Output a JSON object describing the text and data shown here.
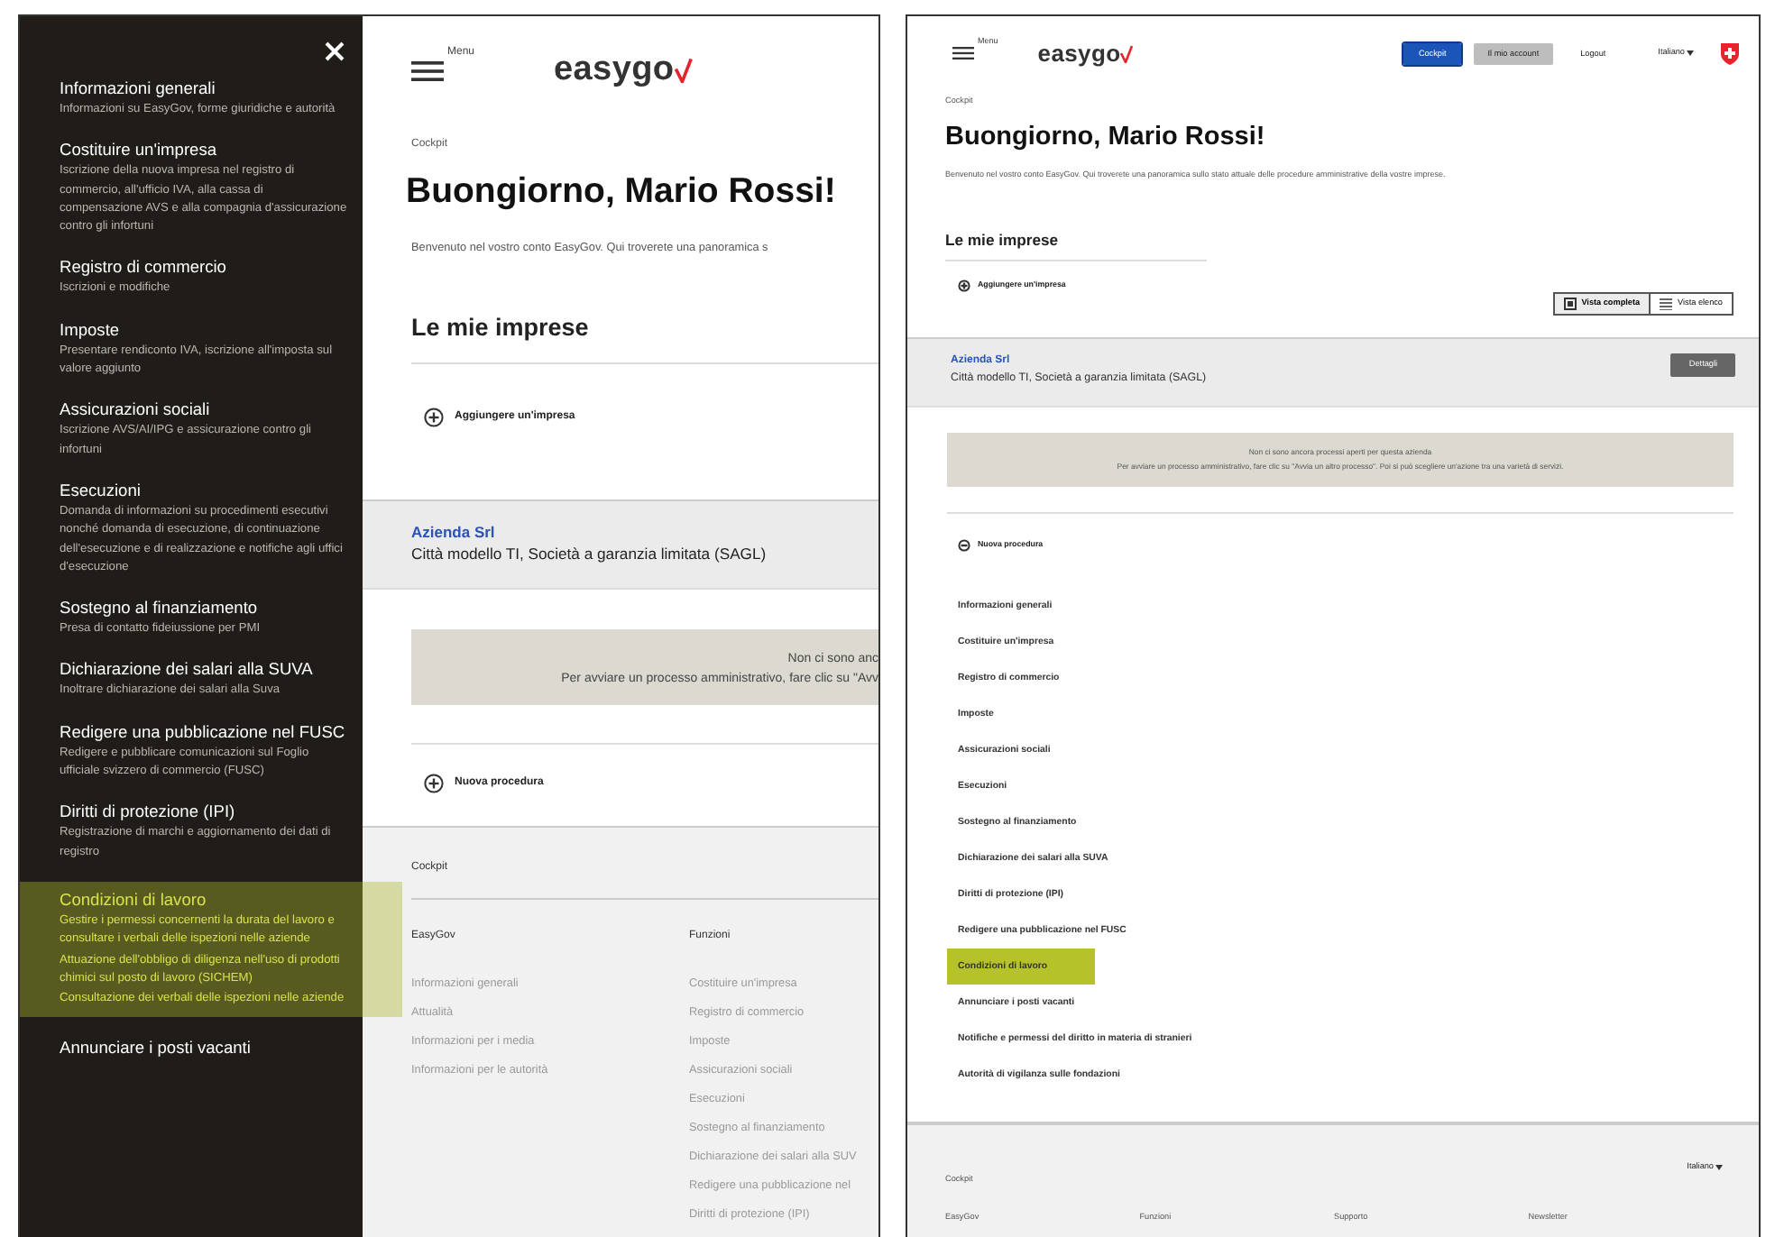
{
  "left_screen": {
    "menu": {
      "items": [
        {
          "title": "Informazioni generali",
          "description": [
            "Informazioni su EasyGov, forme giuridiche e autorità"
          ],
          "selected": false
        },
        {
          "title": "Costituire un'impresa",
          "description": [
            "Iscrizione della nuova impresa nel registro di commercio, all'ufficio IVA, alla cassa di compensazione AVS e alla compagnia d'assicurazione contro gli infortuni"
          ],
          "selected": false
        },
        {
          "title": "Registro di commercio",
          "description": [
            "Iscrizioni e modifiche"
          ],
          "selected": false
        },
        {
          "title": "Imposte",
          "description": [
            "Presentare rendiconto IVA, iscrizione all'imposta sul valore aggiunto"
          ],
          "selected": false
        },
        {
          "title": "Assicurazioni sociali",
          "description": [
            "Iscrizione AVS/AI/IPG e assicurazione contro gli infortuni"
          ],
          "selected": false
        },
        {
          "title": "Esecuzioni",
          "description": [
            "Domanda di informazioni su procedimenti esecutivi nonché domanda di esecuzione, di continuazione dell'esecuzione e di realizzazione e notifiche agli uffici d'esecuzione"
          ],
          "selected": false
        },
        {
          "title": "Sostegno al finanziamento",
          "description": [
            "Presa di contatto fideiussione per PMI"
          ],
          "selected": false
        },
        {
          "title": "Dichiarazione dei salari alla SUVA",
          "description": [
            "Inoltrare dichiarazione dei salari alla Suva"
          ],
          "selected": false
        },
        {
          "title": "Redigere una pubblicazione nel FUSC",
          "description": [
            "Redigere e pubblicare comunicazioni sul Foglio ufficiale svizzero di commercio (FUSC)"
          ],
          "selected": false
        },
        {
          "title": "Diritti di protezione (IPI)",
          "description": [
            "Registrazione di marchi e aggiornamento dei dati di registro"
          ],
          "selected": false
        },
        {
          "title": "Condizioni di lavoro",
          "description": [
            "Gestire i permessi concernenti la durata del lavoro e consultare i verbali delle ispezioni nelle aziende",
            "Attuazione dell'obbligo di diligenza nell'uso di prodotti chimici sul posto di lavoro (SICHEM)",
            "Consultazione dei verbali delle ispezioni nelle aziende"
          ],
          "selected": true
        },
        {
          "title": "Annunciare i posti vacanti",
          "selected": false
        }
      ]
    },
    "header": {
      "menu_label": "Menu",
      "logo": "easygo"
    },
    "breadcrumb": "Cockpit",
    "greeting": "Buongiorno, Mario Rossi!",
    "welcome": "Benvenuto nel vostro conto EasyGov. Qui troverete una panoramica s",
    "section_title": "Le mie imprese",
    "add_company": "Aggiungere un'impresa",
    "company": {
      "name": "Azienda Srl",
      "details": "Città modello TI, Società a garanzia limitata (SAGL)"
    },
    "notice": [
      "Non ci sono anc",
      "Per avviare un processo amministrativo, fare clic su \"Avv"
    ],
    "new_procedure": {
      "label": "Nuova procedura",
      "expanded": false
    },
    "footer": {
      "breadcrumb": "Cockpit",
      "columns": [
        {
          "heading": "EasyGov",
          "links": [
            "Informazioni generali",
            "Attualità",
            "Informazioni per i media",
            "Informazioni per le autorità"
          ]
        },
        {
          "heading": "Funzioni",
          "links": [
            "Costituire un'impresa",
            "Registro di commercio",
            "Imposte",
            "Assicurazioni sociali",
            "Esecuzioni",
            "Sostegno al finanziamento",
            "Dichiarazione dei salari alla SUV",
            "Redigere una pubblicazione nel",
            "Diritti di protezione (IPI)"
          ]
        }
      ]
    }
  },
  "right_screen": {
    "header": {
      "menu_label": "Menu",
      "logo": "easygo",
      "nav": [
        {
          "label": "Cockpit",
          "kind": "primary",
          "selected": true
        },
        {
          "label": "Il mio account",
          "kind": "secondary",
          "selected": false
        },
        {
          "label": "Logout",
          "kind": "link",
          "selected": false
        }
      ],
      "language": "Italiano"
    },
    "breadcrumb": "Cockpit",
    "greeting": "Buongiorno, Mario Rossi!",
    "welcome": "Benvenuto nel vostro conto EasyGov. Qui troverete una panoramica sullo stato attuale delle procedure amministrative della vostre imprese.",
    "section_title": "Le mie imprese",
    "add_company": "Aggiungere un'impresa",
    "views": [
      {
        "label": "Vista completa",
        "selected": true
      },
      {
        "label": "Vista elenco",
        "selected": false
      }
    ],
    "company": {
      "name": "Azienda Srl",
      "details": "Città modello TI, Società a garanzia limitata (SAGL)",
      "details_button": "Dettagli"
    },
    "notice": [
      "Non ci sono ancora processi aperti per questa azienda",
      "Per avviare un processo amministrativo, fare clic su \"Avvia un altro processo\". Poi si può scegliere un'azione tra una varietà di servizi."
    ],
    "new_procedure": {
      "label": "Nuova procedura",
      "expanded": true
    },
    "procedures": [
      {
        "label": "Informazioni generali",
        "selected": false
      },
      {
        "label": "Costituire un'impresa",
        "selected": false
      },
      {
        "label": "Registro di commercio",
        "selected": false
      },
      {
        "label": "Imposte",
        "selected": false
      },
      {
        "label": "Assicurazioni sociali",
        "selected": false
      },
      {
        "label": "Esecuzioni",
        "selected": false
      },
      {
        "label": "Sostegno al finanziamento",
        "selected": false
      },
      {
        "label": "Dichiarazione dei salari alla SUVA",
        "selected": false
      },
      {
        "label": "Diritti di protezione (IPI)",
        "selected": false
      },
      {
        "label": "Redigere una pubblicazione nel FUSC",
        "selected": false
      },
      {
        "label": "Condizioni di lavoro",
        "selected": true
      },
      {
        "label": "Annunciare i posti vacanti",
        "selected": false
      },
      {
        "label": "Notifiche e permessi del diritto in materia di stranieri",
        "selected": false
      },
      {
        "label": "Autorità di vigilanza sulle fondazioni",
        "selected": false
      }
    ],
    "footer": {
      "breadcrumb": "Cockpit",
      "language": "Italiano",
      "column_headings": [
        "EasyGov",
        "Funzioni",
        "Supporto",
        "Newsletter"
      ]
    }
  }
}
